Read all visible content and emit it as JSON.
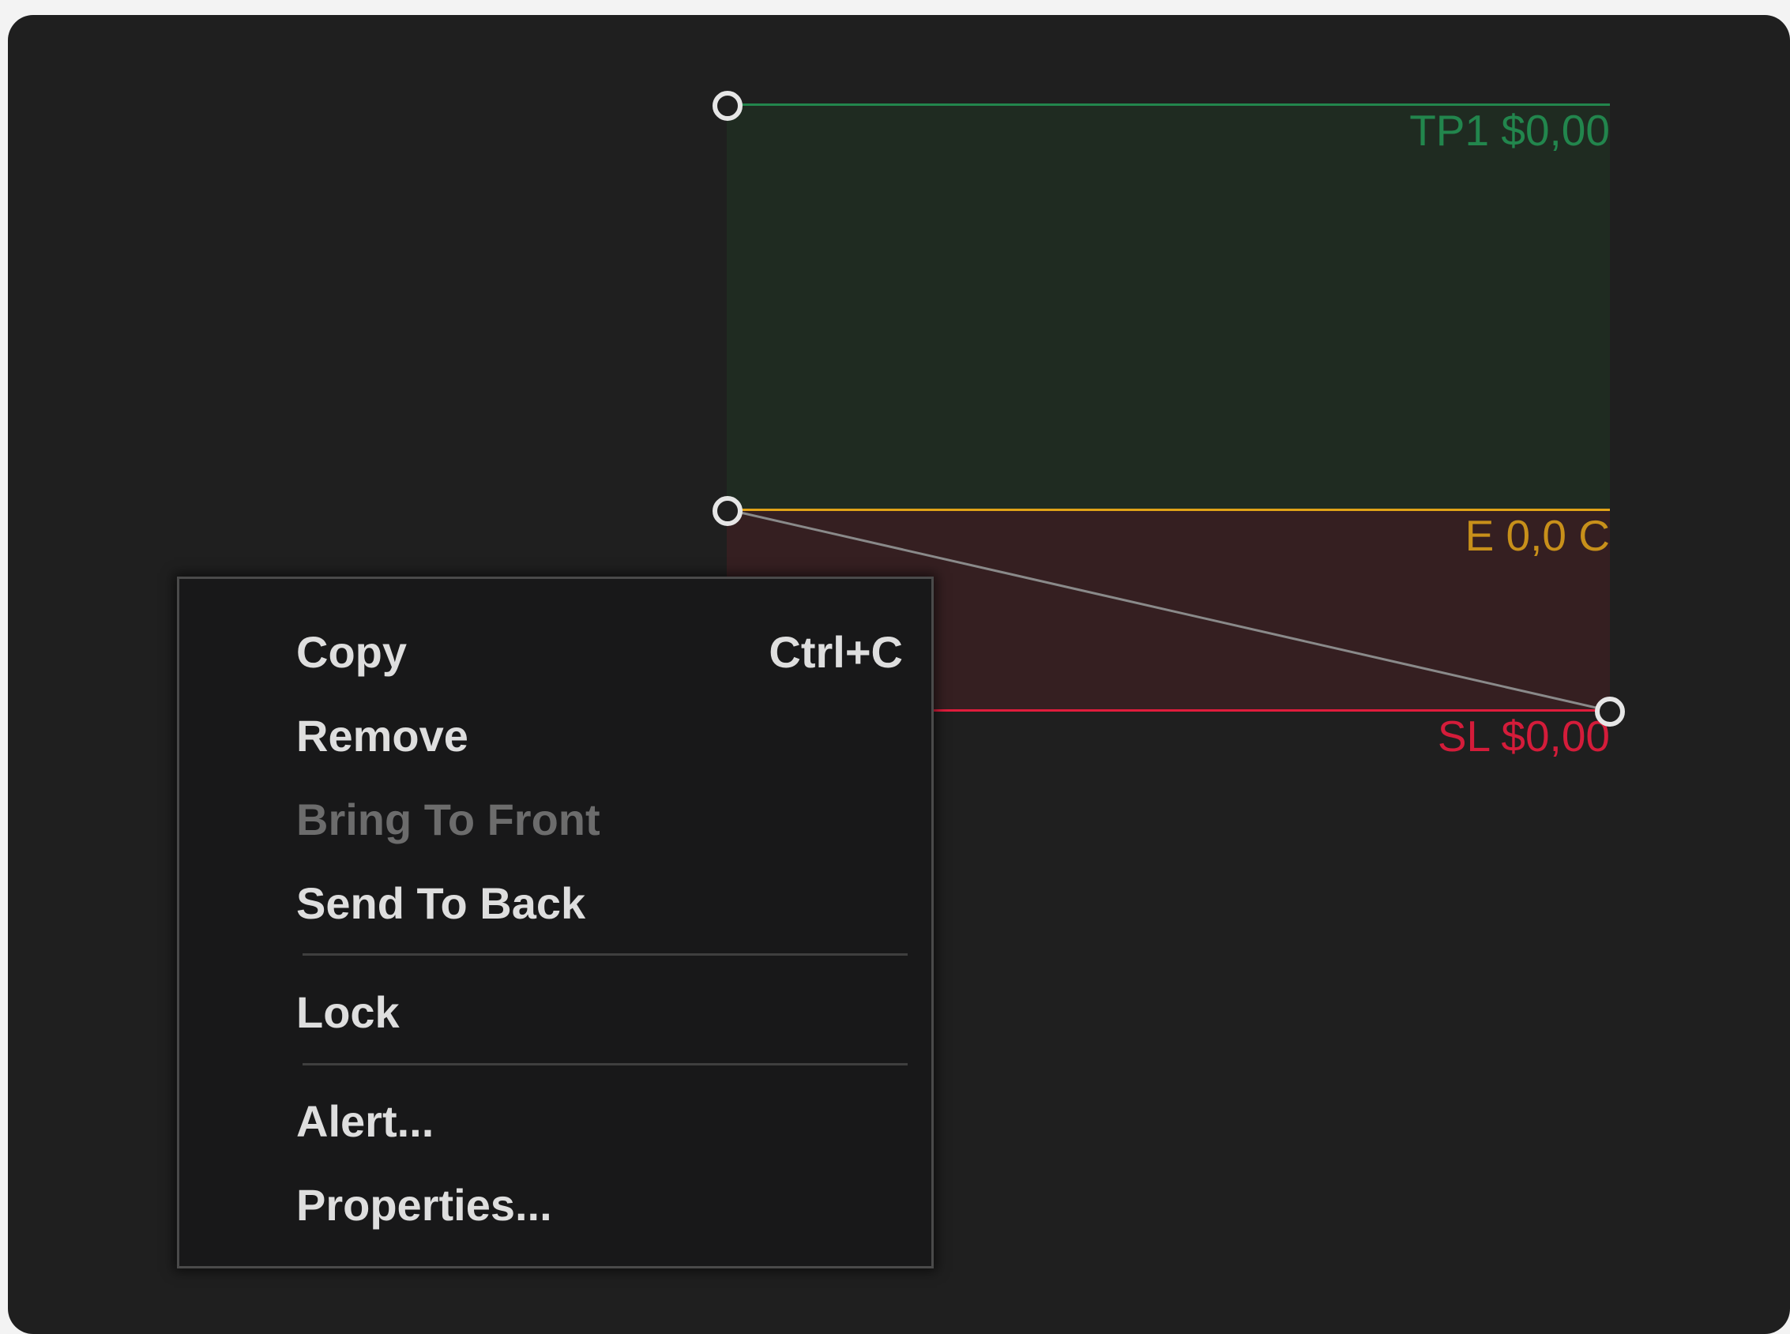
{
  "drawing": {
    "tp_label": "TP1 $0,00",
    "entry_label": "E 0,0 C",
    "sl_label": "SL $0,00",
    "colors": {
      "profit_line": "#22864d",
      "entry_line": "#e0a318",
      "stop_line": "#e01c3c",
      "profit_fill": "#1f2b21",
      "loss_fill": "#351f21"
    }
  },
  "context_menu": {
    "items": [
      {
        "label": "Copy",
        "shortcut": "Ctrl+C",
        "enabled": true
      },
      {
        "label": "Remove",
        "enabled": true
      },
      {
        "label": "Bring To Front",
        "enabled": false
      },
      {
        "label": "Send To Back",
        "enabled": true
      },
      {
        "label": "Lock",
        "enabled": true
      },
      {
        "label": "Alert...",
        "enabled": true
      },
      {
        "label": "Properties...",
        "enabled": true
      }
    ]
  }
}
